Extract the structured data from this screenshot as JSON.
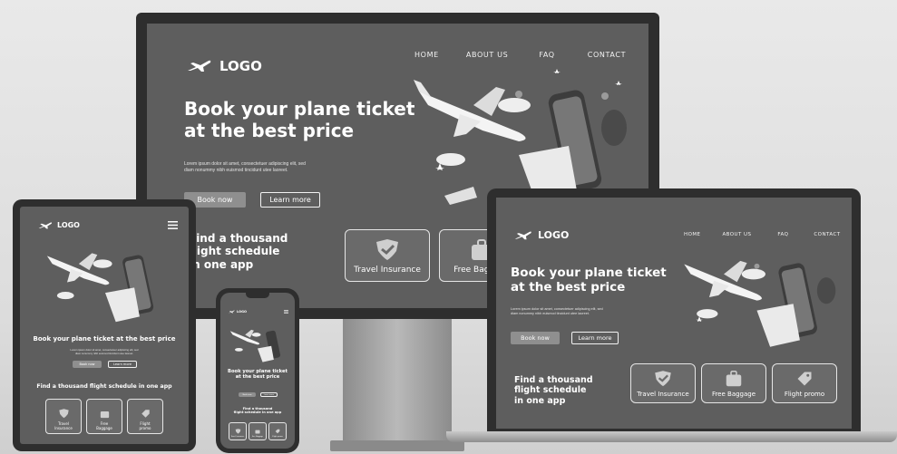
{
  "brand": {
    "logo_text": "LOGO"
  },
  "nav": {
    "home": "HOME",
    "about": "ABOUT US",
    "faq": "FAQ",
    "contact": "CONTACT"
  },
  "hero": {
    "title_line1": "Book your plane ticket",
    "title_line2": "at the best price",
    "title_single": "Book your plane ticket at the best price",
    "body_line1": "Lorem ipsum dolor sit amet, consectetuer adipiscing elit, sed",
    "body_line2": "diam nonummy nibh euismod tincidunt utee laoreet."
  },
  "buttons": {
    "book": "Book now",
    "learn": "Learn more"
  },
  "features": {
    "heading_line1": "Find a thousand",
    "heading_line2": "flight schedule",
    "heading_line3": "in one app",
    "heading_single": "Find a thousand flight schedule in one app",
    "cards": [
      {
        "label": "Travel Insurance",
        "icon": "shield-check-icon"
      },
      {
        "label": "Free Baggage",
        "icon": "suitcase-icon"
      },
      {
        "label": "Flight promo",
        "icon": "tag-icon"
      }
    ]
  },
  "colors": {
    "screen": "#5e5e5e",
    "bezel": "#2e2e2e",
    "button": "#8f8f8f"
  }
}
